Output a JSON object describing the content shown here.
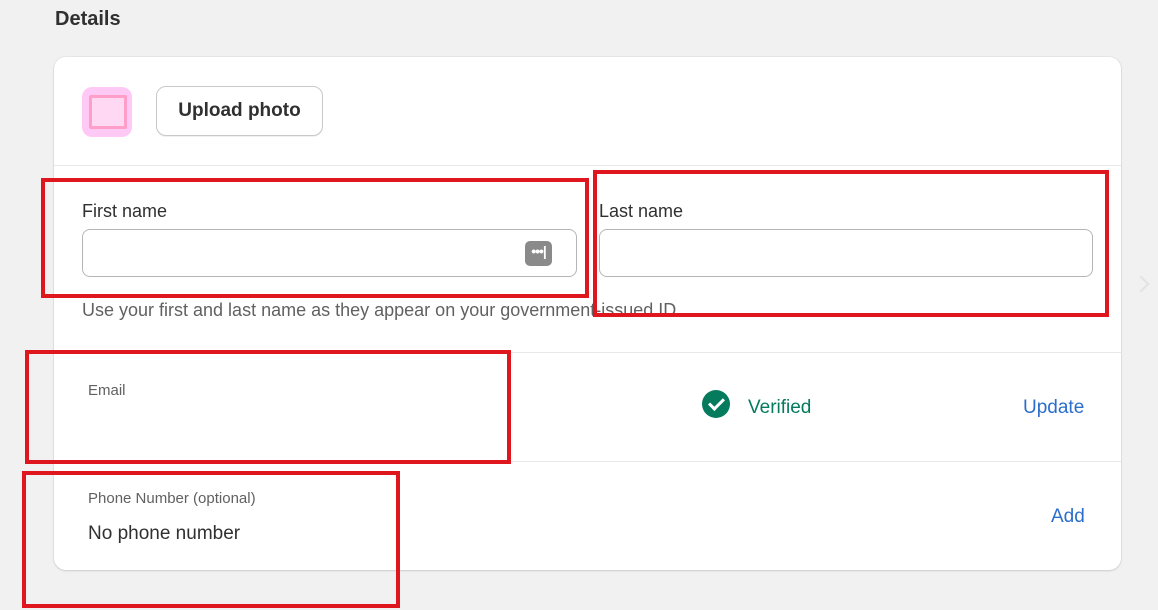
{
  "section": {
    "title": "Details"
  },
  "photo": {
    "upload_label": "Upload photo"
  },
  "name": {
    "first_label": "First name",
    "first_value": "",
    "password_manager_icon": "•••|",
    "last_label": "Last name",
    "last_value": "",
    "helper": "Use your first and last name as they appear on your government-issued ID."
  },
  "email": {
    "label": "Email",
    "value": "",
    "status": "Verified",
    "action": "Update"
  },
  "phone": {
    "label": "Phone Number (optional)",
    "value": "No phone number",
    "action": "Add"
  },
  "colors": {
    "verified": "#047b5d",
    "link": "#2c6ecb",
    "annotation": "#e0161f",
    "avatar_bg": "#ffc9f6"
  },
  "icons": {
    "status": "check-circle-icon",
    "nav": "chevron-right-icon"
  }
}
